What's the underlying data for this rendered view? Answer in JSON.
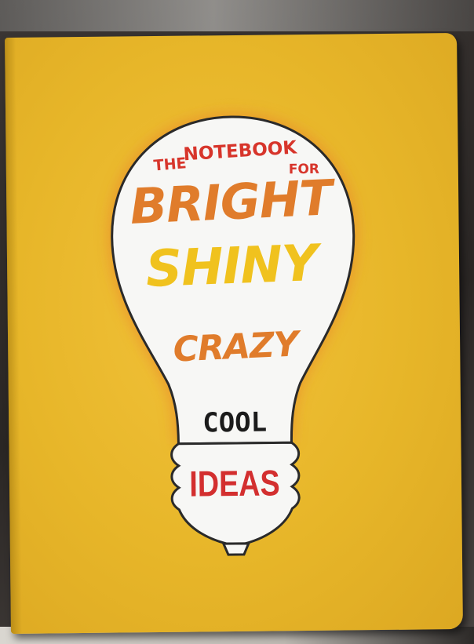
{
  "cover": {
    "line_the": "THE",
    "line_notebook": "NOTEBOOK",
    "line_for": "FOR",
    "word_bright": "BRIGHT",
    "word_shiny": "SHINY",
    "word_crazy": "CRAZY",
    "word_cool": "COOL",
    "word_ideas": "IDEAS"
  },
  "colors": {
    "cover_yellow": "#e7b629",
    "bulb_white": "#f7f7f5",
    "red_text": "#d7352b",
    "orange_text": "#e07c2b",
    "yellow_text": "#f0c21e",
    "black_text": "#1b1b1b"
  },
  "icons": [
    "light-bulb-icon"
  ]
}
